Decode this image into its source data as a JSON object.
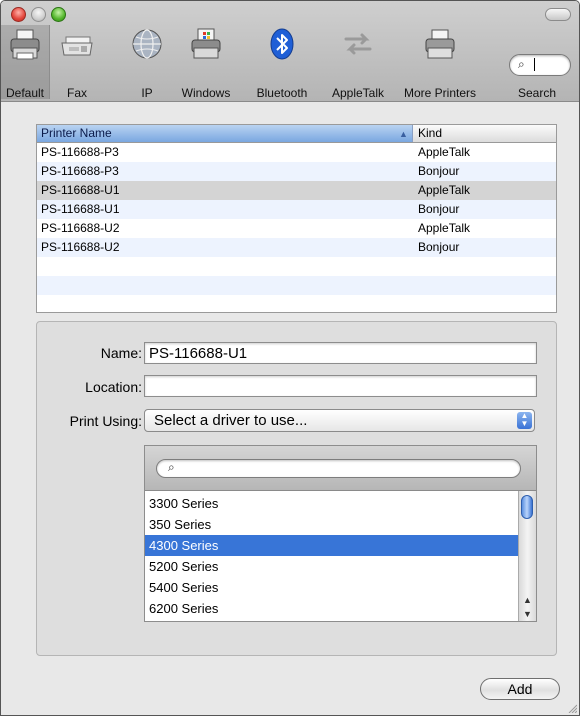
{
  "toolbar": {
    "items": [
      {
        "label": "Default",
        "icon": "printer-icon"
      },
      {
        "label": "Fax",
        "icon": "fax-icon"
      },
      {
        "label": "IP",
        "icon": "globe-icon"
      },
      {
        "label": "Windows",
        "icon": "windows-printer-icon"
      },
      {
        "label": "Bluetooth",
        "icon": "bluetooth-icon"
      },
      {
        "label": "AppleTalk",
        "icon": "appletalk-arrows-icon"
      },
      {
        "label": "More Printers",
        "icon": "printer-icon"
      },
      {
        "label": "Search",
        "icon": "search-icon"
      }
    ],
    "search_value": ""
  },
  "printer_list": {
    "columns": [
      "Printer Name",
      "Kind"
    ],
    "rows": [
      {
        "name": "PS-116688-P3",
        "kind": "AppleTalk"
      },
      {
        "name": "PS-116688-P3",
        "kind": "Bonjour"
      },
      {
        "name": "PS-116688-U1",
        "kind": "AppleTalk"
      },
      {
        "name": "PS-116688-U1",
        "kind": "Bonjour"
      },
      {
        "name": "PS-116688-U2",
        "kind": "AppleTalk"
      },
      {
        "name": "PS-116688-U2",
        "kind": "Bonjour"
      }
    ],
    "selected_index": 2
  },
  "form": {
    "name_label": "Name:",
    "name_value": "PS-116688-U1",
    "location_label": "Location:",
    "location_value": "",
    "print_using_label": "Print Using:",
    "print_using_value": "Select a driver to use..."
  },
  "drivers": {
    "search_value": "",
    "items": [
      "3300 Series",
      "350 Series",
      "4300 Series",
      "5200 Series",
      "5400 Series",
      "6200 Series"
    ],
    "selected_index": 2
  },
  "add_button": "Add"
}
